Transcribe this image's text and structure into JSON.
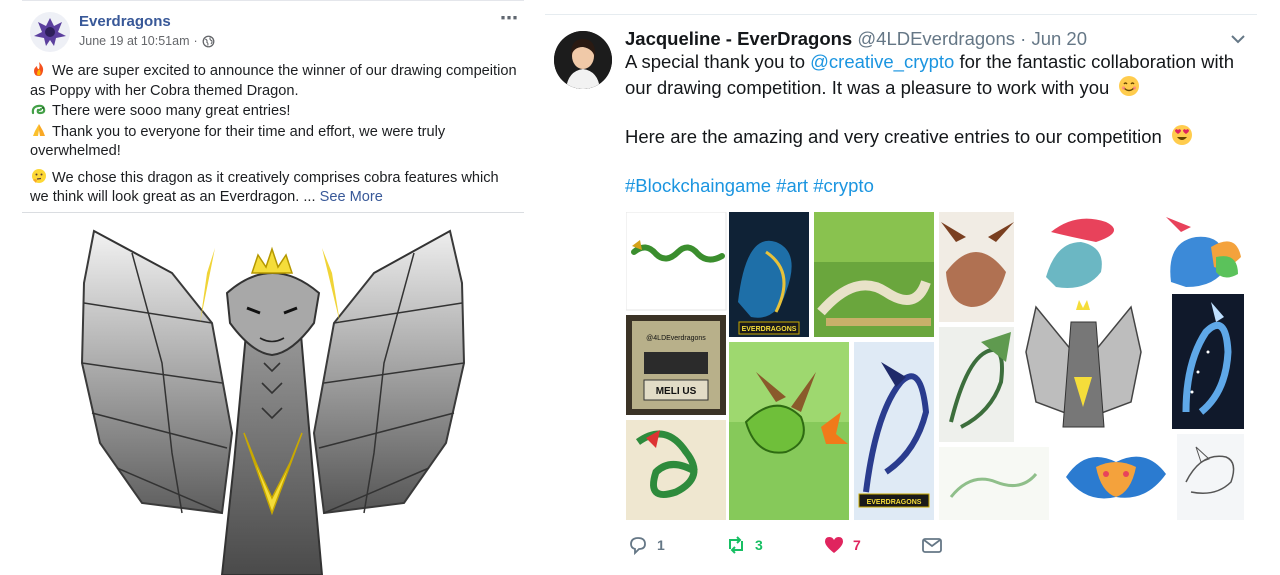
{
  "facebook_post": {
    "page_name": "Everdragons",
    "timestamp": "June 19 at 10:51am",
    "separator": "·",
    "paragraphs": [
      {
        "icon": "fire-emoji",
        "text": "We are super excited to announce the winner of our drawing compeition as Poppy with her Cobra themed Dragon."
      },
      {
        "icon": "dragon-emoji",
        "text": "There were sooo many great entries!"
      },
      {
        "icon": "praying-hands-emoji",
        "text": "Thank you to everyone for their time and effort, we were truly overwhelmed!"
      },
      {
        "icon": "thinking-face-emoji",
        "text": "We chose this dragon as it creatively comprises cobra features which we think will look great as an Everdragon. ..."
      }
    ],
    "see_more": "See More",
    "more_icon": "⋯"
  },
  "tweet": {
    "author": "Jacqueline - EverDragons",
    "handle": "@4LDEverdragons",
    "separator": "·",
    "date": "Jun 20",
    "line1_before": "A special thank you to ",
    "mention": "@creative_crypto",
    "line1_after": " for the fantastic collaboration with our drawing competition. It was a pleasure to work with you",
    "line2": "Here are the amazing and very creative entries to our competition",
    "hashtags": "#Blockchaingame #art #crypto",
    "collage_text": {
      "tile_a": "EVERDRAGONS",
      "tile_b": "@4LDEverdragons",
      "tile_c": "MELI US",
      "tile_d": "EVERDRAGONS"
    },
    "actions": {
      "replies": "1",
      "retweets": "3",
      "likes": "7"
    }
  },
  "colors": {
    "fb_link": "#385898",
    "tw_link": "#1b95e0",
    "tw_retweet": "#17bf63",
    "tw_like": "#e0245e",
    "tw_gray": "#657786"
  }
}
